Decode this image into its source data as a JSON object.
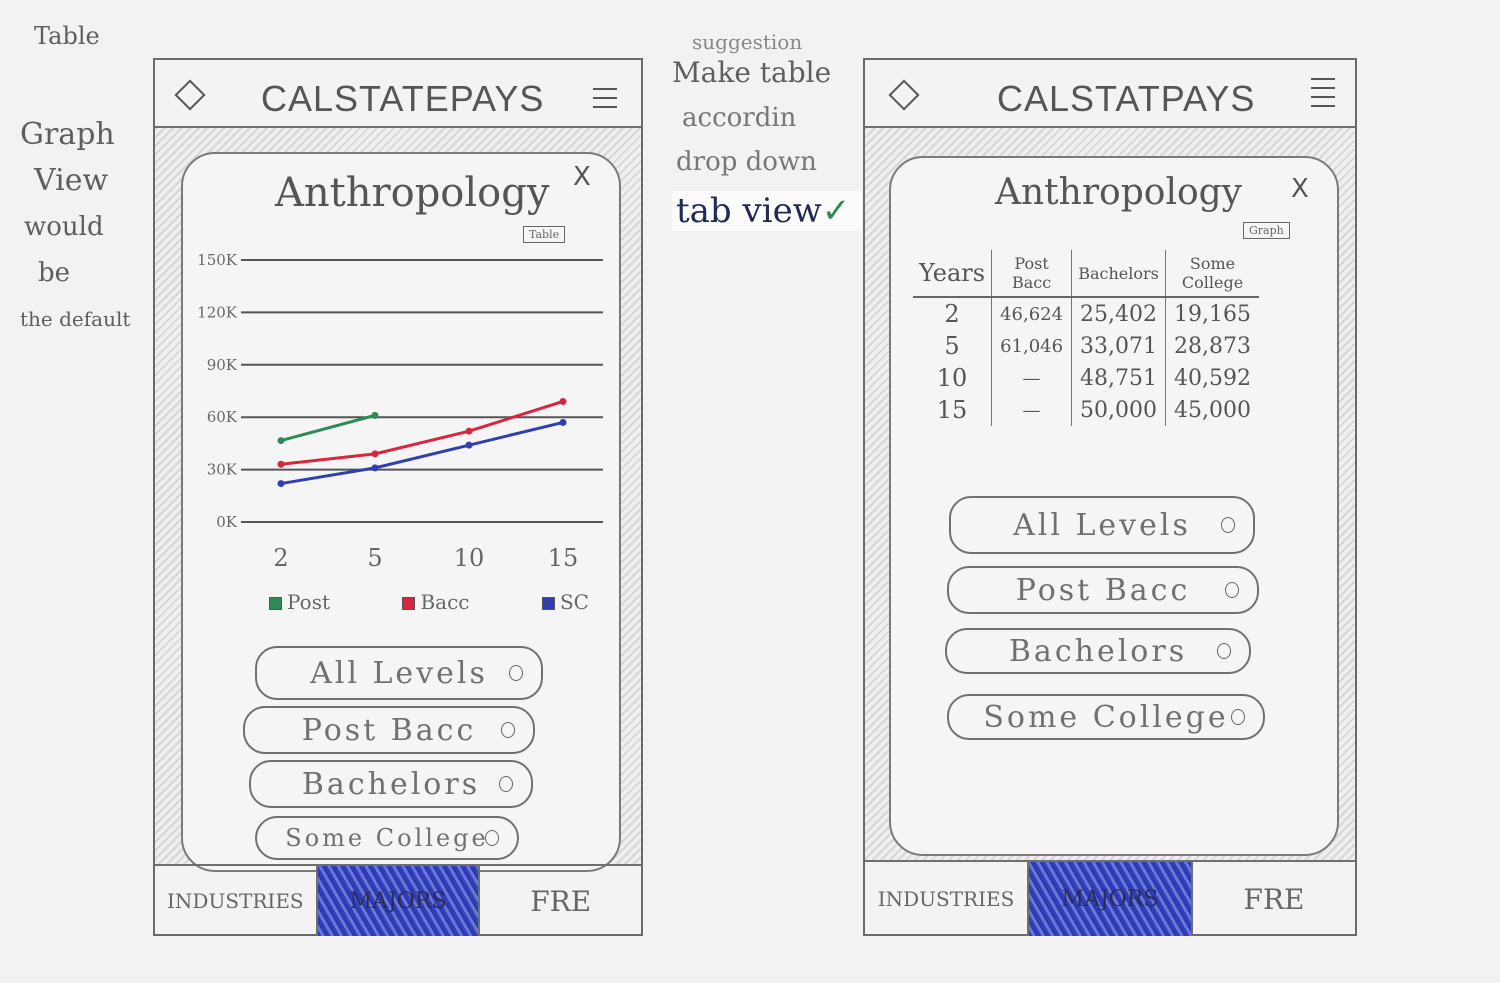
{
  "notes": {
    "faint_corner": "Table",
    "graph_default": [
      "Graph",
      "View",
      "would",
      "be",
      "the default"
    ],
    "suggestion": {
      "heading": "suggestion",
      "lines": [
        "Make table",
        "accordin",
        "drop down"
      ],
      "choice": "tab view",
      "check": "✓"
    }
  },
  "left_phone": {
    "title": "CALSTATEPAYS",
    "modal_title": "Anthropology",
    "toggle_label": "Table",
    "close_symbol": "X",
    "legend": [
      {
        "label": "Post",
        "color": "#2e8b57"
      },
      {
        "label": "Bacc",
        "color": "#d7263d"
      },
      {
        "label": "SC",
        "color": "#2f3fb0"
      }
    ],
    "filters": [
      "All Levels",
      "Post Bacc",
      "Bachelors",
      "Some College"
    ],
    "tabs": [
      "INDUSTRIES",
      "MAJORS",
      "FRE"
    ],
    "active_tab": 1
  },
  "right_phone": {
    "title": "CALSTATPAYS",
    "modal_title": "Anthropology",
    "toggle_label": "Graph",
    "close_symbol": "X",
    "table": {
      "headers": [
        "Years",
        "Post Bacc",
        "Bachelors",
        "Some College"
      ],
      "rows": [
        [
          "2",
          "46,624",
          "25,402",
          "19,165"
        ],
        [
          "5",
          "61,046",
          "33,071",
          "28,873"
        ],
        [
          "10",
          "—",
          "48,751",
          "40,592"
        ],
        [
          "15",
          "—",
          "50,000",
          "45,000"
        ]
      ]
    },
    "filters": [
      "All Levels",
      "Post Bacc",
      "Bachelors",
      "Some College"
    ],
    "tabs": [
      "INDUSTRIES",
      "MAJORS",
      "FRE"
    ],
    "active_tab": 1
  },
  "chart_data": {
    "type": "line",
    "x": [
      2,
      5,
      10,
      15
    ],
    "x_tick_labels": [
      "2",
      "5",
      "10",
      "15"
    ],
    "y_tick_labels": [
      "0K",
      "30K",
      "60K",
      "90K",
      "120K",
      "150K"
    ],
    "y_ticks": [
      0,
      30000,
      60000,
      90000,
      120000,
      150000
    ],
    "ylim": [
      0,
      150000
    ],
    "grid": true,
    "legend_position": "bottom",
    "series": [
      {
        "name": "Post",
        "color": "#2e8b57",
        "x": [
          2,
          5
        ],
        "values": [
          46624,
          61046
        ]
      },
      {
        "name": "Bacc",
        "color": "#d7263d",
        "x": [
          2,
          5,
          10,
          15
        ],
        "values": [
          33071,
          39000,
          52000,
          69000
        ]
      },
      {
        "name": "SC",
        "color": "#2f3fb0",
        "x": [
          2,
          5,
          10,
          15
        ],
        "values": [
          22000,
          31000,
          44000,
          57000
        ]
      }
    ]
  }
}
